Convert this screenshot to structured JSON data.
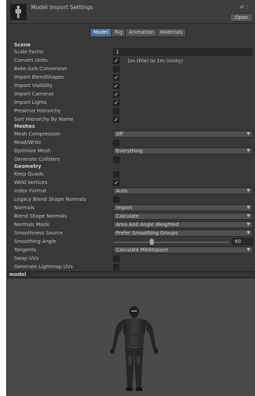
{
  "header": {
    "title": "Model Import Settings",
    "icons": [
      "sliders-icon",
      "kebab-menu-icon"
    ],
    "open_label": "Open"
  },
  "tabs": [
    {
      "label": "Model",
      "active": true
    },
    {
      "label": "Rig",
      "active": false
    },
    {
      "label": "Animation",
      "active": false
    },
    {
      "label": "Materials",
      "active": false
    }
  ],
  "sections": {
    "scene": "Scene",
    "meshes": "Meshes",
    "geometry": "Geometry"
  },
  "scene": {
    "scale_factor": {
      "label": "Scale Factor",
      "value": "1"
    },
    "convert_units": {
      "label": "Convert Units",
      "checked": true,
      "note": "1m (File) to 1m (Unity)"
    },
    "bake_axis_conversion": {
      "label": "Bake Axis Conversion",
      "checked": false
    },
    "import_blendshapes": {
      "label": "Import BlendShapes",
      "checked": true
    },
    "import_visibility": {
      "label": "Import Visibility",
      "checked": true
    },
    "import_cameras": {
      "label": "Import Cameras",
      "checked": true
    },
    "import_lights": {
      "label": "Import Lights",
      "checked": true
    },
    "preserve_hierarchy": {
      "label": "Preserve Hierarchy",
      "checked": false
    },
    "sort_hierarchy": {
      "label": "Sort Hierarchy By Name",
      "checked": true
    }
  },
  "meshes": {
    "mesh_compression": {
      "label": "Mesh Compression",
      "value": "Off"
    },
    "read_write": {
      "label": "Read/Write",
      "checked": false
    },
    "optimize_mesh": {
      "label": "Optimize Mesh",
      "value": "Everything"
    },
    "generate_colliders": {
      "label": "Generate Colliders",
      "checked": false
    }
  },
  "geometry": {
    "keep_quads": {
      "label": "Keep Quads",
      "checked": false
    },
    "weld_vertices": {
      "label": "Weld Vertices",
      "checked": true
    },
    "index_format": {
      "label": "Index Format",
      "value": "Auto"
    },
    "legacy_blend_shape_normals": {
      "label": "Legacy Blend Shape Normals",
      "checked": false
    },
    "normals": {
      "label": "Normals",
      "value": "Import"
    },
    "blend_shape_normals": {
      "label": "Blend Shape Normals",
      "value": "Calculate"
    },
    "normals_mode": {
      "label": "Normals Mode",
      "value": "Area And Angle Weighted"
    },
    "smoothness_source": {
      "label": "Smoothness Source",
      "value": "Prefer Smoothing Groups"
    },
    "smoothing_angle": {
      "label": "Smoothing Angle",
      "value": "60",
      "max": 180
    },
    "tangents": {
      "label": "Tangents",
      "value": "Calculate Mikktspace"
    },
    "swap_uvs": {
      "label": "Swap UVs",
      "checked": false
    },
    "generate_lightmap_uvs": {
      "label": "Generate Lightmap UVs",
      "checked": false
    }
  },
  "preview": {
    "title": "model"
  },
  "colors": {
    "panel_bg": "#383838",
    "active_tab": "#4b6e96",
    "preview_bg": "#4a4a4a"
  }
}
